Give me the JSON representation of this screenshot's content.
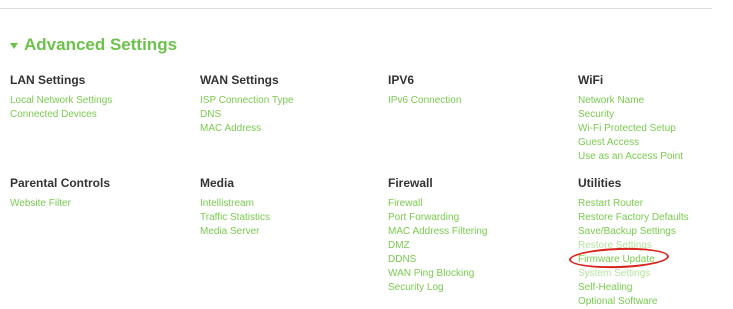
{
  "section": {
    "title": "Advanced Settings"
  },
  "groups": {
    "lan": {
      "title": "LAN Settings",
      "links": [
        "Local Network Settings",
        "Connected Devices"
      ]
    },
    "wan": {
      "title": "WAN Settings",
      "links": [
        "ISP Connection Type",
        "DNS",
        "MAC Address"
      ]
    },
    "ipv6": {
      "title": "IPV6",
      "links": [
        "IPv6 Connection"
      ]
    },
    "wifi": {
      "title": "WiFi",
      "links": [
        "Network Name",
        "Security",
        "Wi-Fi Protected Setup",
        "Guest Access",
        "Use as an Access Point"
      ]
    },
    "parental": {
      "title": "Parental Controls",
      "links": [
        "Website Filter"
      ]
    },
    "media": {
      "title": "Media",
      "links": [
        "Intellistream",
        "Traffic Statistics",
        "Media Server"
      ]
    },
    "firewall": {
      "title": "Firewall",
      "links": [
        "Firewall",
        "Port Forwarding",
        "MAC Address Filtering",
        "DMZ",
        "DDNS",
        "WAN Ping Blocking",
        "Security Log"
      ]
    },
    "utilities": {
      "title": "Utilities",
      "links": [
        "Restart Router",
        "Restore Factory Defaults",
        "Save/Backup Settings",
        "Restore Settings",
        "Firmware Update",
        "System Settings",
        "Self-Healing",
        "Optional Software"
      ]
    }
  },
  "colors": {
    "accent": "#6cc24a",
    "link": "#7acb4f",
    "heading": "#333333",
    "highlight_ring": "#d8241b"
  },
  "icons": {
    "section_toggle": "caret-down-icon"
  }
}
